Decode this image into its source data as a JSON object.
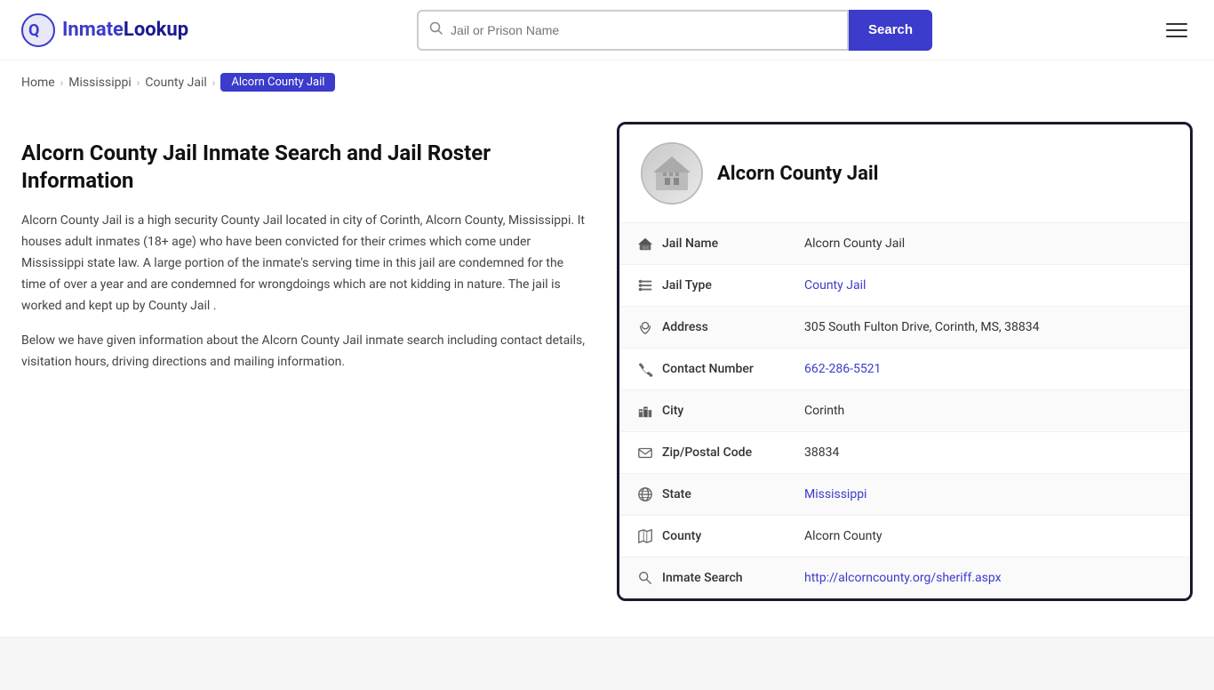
{
  "logo": {
    "text": "InmateLookup",
    "icon_label": "inmate-lookup-logo"
  },
  "search": {
    "placeholder": "Jail or Prison Name",
    "button_label": "Search"
  },
  "breadcrumb": {
    "items": [
      {
        "label": "Home",
        "href": "#"
      },
      {
        "label": "Mississippi",
        "href": "#"
      },
      {
        "label": "County Jail",
        "href": "#"
      },
      {
        "label": "Alcorn County Jail",
        "current": true
      }
    ]
  },
  "left": {
    "heading": "Alcorn County Jail Inmate Search and Jail Roster Information",
    "paragraph1": "Alcorn County Jail is a high security County Jail located in city of Corinth, Alcorn County, Mississippi. It houses adult inmates (18+ age) who have been convicted for their crimes which come under Mississippi state law. A large portion of the inmate's serving time in this jail are condemned for the time of over a year and are condemned for wrongdoings which are not kidding in nature. The jail is worked and kept up by County Jail .",
    "paragraph2": "Below we have given information about the Alcorn County Jail inmate search including contact details, visitation hours, driving directions and mailing information."
  },
  "card": {
    "title": "Alcorn County Jail",
    "avatar_icon": "🏛",
    "rows": [
      {
        "icon": "🏛",
        "label": "Jail Name",
        "value": "Alcorn County Jail",
        "link": null
      },
      {
        "icon": "≡",
        "label": "Jail Type",
        "value": "County Jail",
        "link": "#"
      },
      {
        "icon": "📍",
        "label": "Address",
        "value": "305 South Fulton Drive, Corinth, MS, 38834",
        "link": null
      },
      {
        "icon": "📞",
        "label": "Contact Number",
        "value": "662-286-5521",
        "link": "tel:6622865521"
      },
      {
        "icon": "🏙",
        "label": "City",
        "value": "Corinth",
        "link": null
      },
      {
        "icon": "✉",
        "label": "Zip/Postal Code",
        "value": "38834",
        "link": null
      },
      {
        "icon": "🌐",
        "label": "State",
        "value": "Mississippi",
        "link": "#"
      },
      {
        "icon": "🗺",
        "label": "County",
        "value": "Alcorn County",
        "link": null
      },
      {
        "icon": "🔍",
        "label": "Inmate Search",
        "value": "http://alcorncounty.org/sheriff.aspx",
        "link": "http://alcorncounty.org/sheriff.aspx"
      }
    ]
  }
}
